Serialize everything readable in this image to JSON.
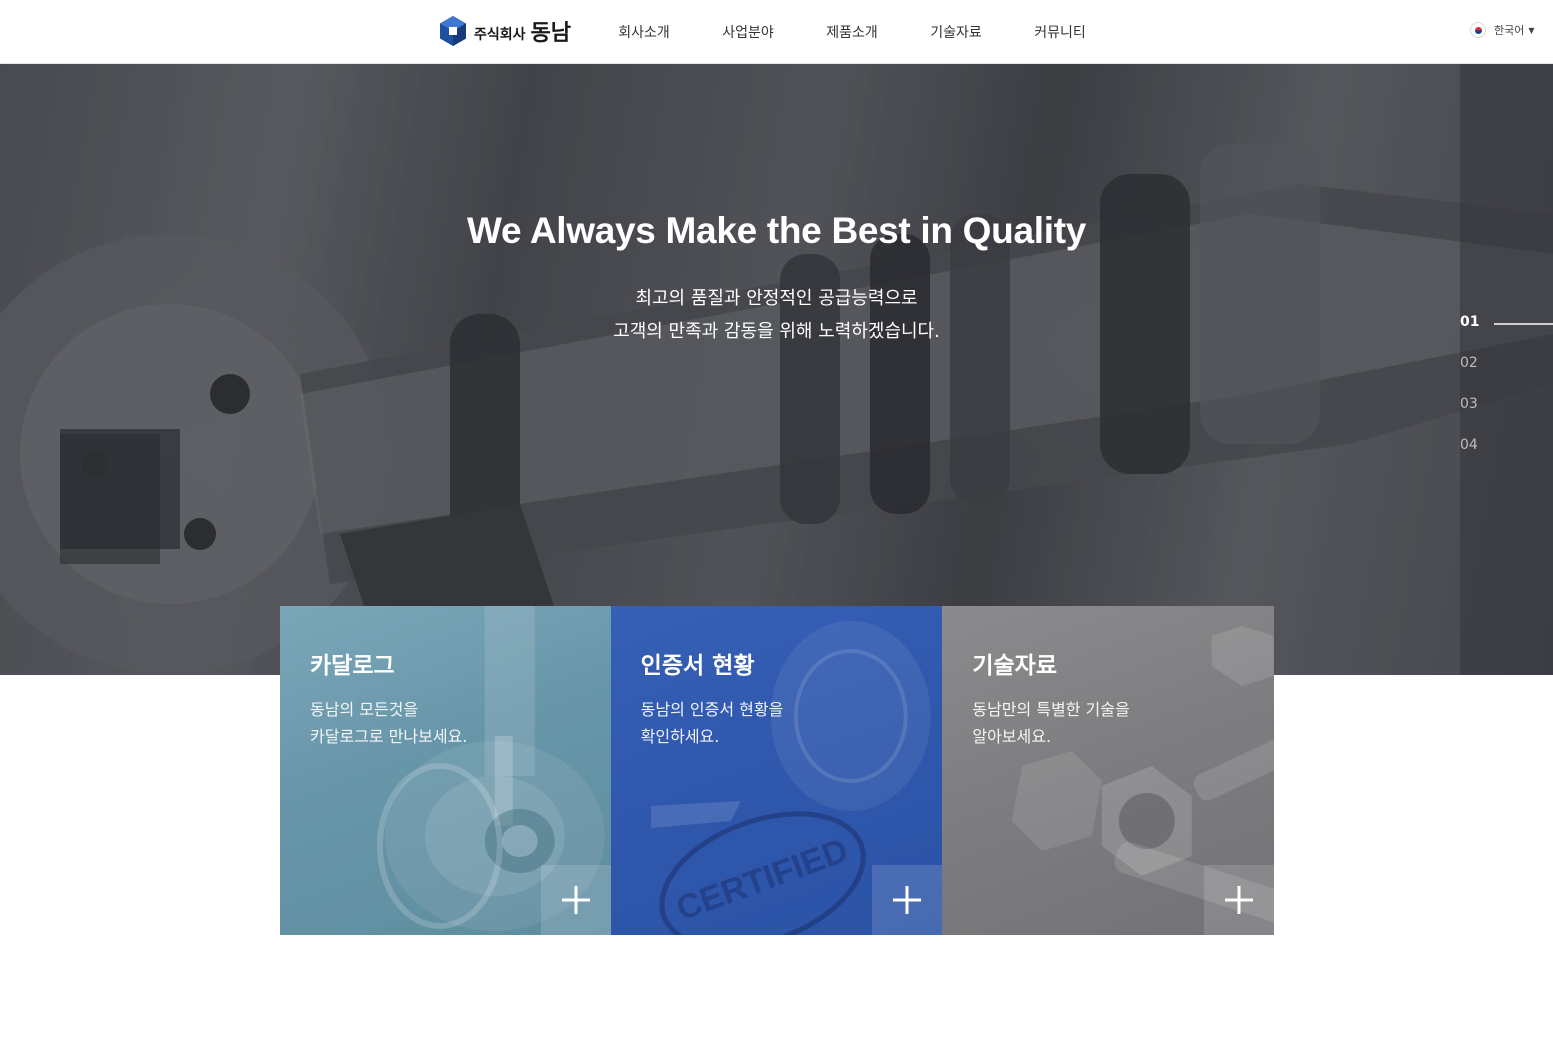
{
  "header": {
    "logo_small": "주식회사",
    "logo_big": "동남",
    "nav": [
      "회사소개",
      "사업분야",
      "제품소개",
      "기술자료",
      "커뮤니티"
    ],
    "language": "한국어"
  },
  "hero": {
    "title": "We Always Make the Best in Quality",
    "subtitle_line1": "최고의 품질과 안정적인 공급능력으로",
    "subtitle_line2": "고객의 만족과 감동을 위해 노력하겠습니다.",
    "pager": [
      "01",
      "02",
      "03",
      "04"
    ],
    "active_slide": "01"
  },
  "cards": [
    {
      "title": "카달로그",
      "desc": "동남의 모든것을\n카달로그로 만나보세요.",
      "color": "#6a97aa"
    },
    {
      "title": "인증서 현황",
      "desc": "동남의 인증서 현황을\n확인하세요.",
      "color": "#2f58ad",
      "stamp_text": "CERTIFIED"
    },
    {
      "title": "기술자료",
      "desc": "동남만의 특별한 기술을\n알아보세요.",
      "color": "#7e7e81"
    }
  ],
  "colors": {
    "brand_blue": "#1f4fa0",
    "hero_overlay": "#2e3036"
  },
  "icons": {
    "logo": "hexagon-logo-icon",
    "language_caret": "caret-down-icon",
    "card_more": "plus-icon"
  }
}
